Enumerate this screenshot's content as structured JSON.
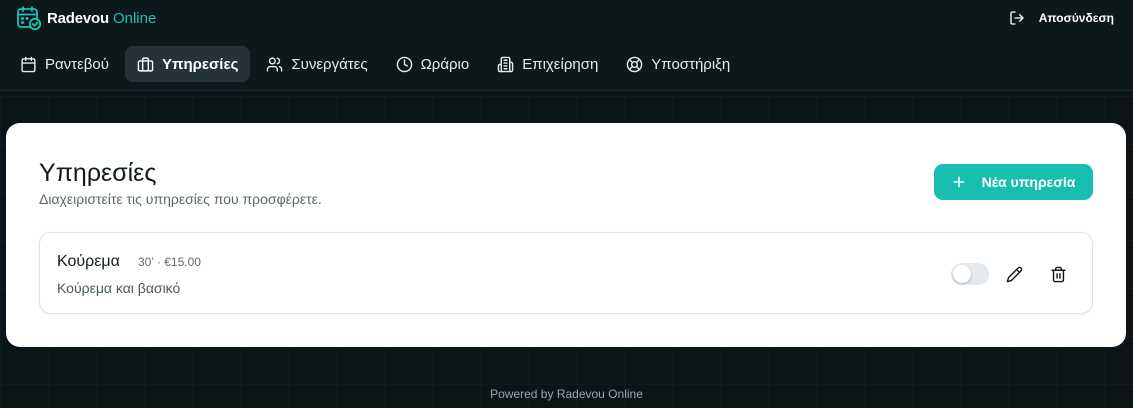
{
  "brand": {
    "name": "Radevou",
    "suffix": "Online",
    "accent_color": "#19c2b2"
  },
  "header": {
    "logout_label": "Αποσύνδεση",
    "logout_icon": "log-out-icon"
  },
  "nav": {
    "items": [
      {
        "label": "Ραντεβού",
        "icon": "calendar-icon",
        "active": false
      },
      {
        "label": "Υπηρεσίες",
        "icon": "briefcase-icon",
        "active": true
      },
      {
        "label": "Συνεργάτες",
        "icon": "users-icon",
        "active": false
      },
      {
        "label": "Ωράριο",
        "icon": "clock-icon",
        "active": false
      },
      {
        "label": "Επιχείρηση",
        "icon": "building-icon",
        "active": false
      },
      {
        "label": "Υποστήριξη",
        "icon": "lifebuoy-icon",
        "active": false
      }
    ]
  },
  "main": {
    "title": "Υπηρεσίες",
    "subtitle": "Διαχειριστείτε τις υπηρεσίες που προσφέρετε.",
    "new_button_label": "Νέα υπηρεσία",
    "new_button_icon": "plus-icon",
    "button_color": "#18bfae"
  },
  "services": [
    {
      "name": "Κούρεμα",
      "meta": "30’ · €15.00",
      "description": "Κούρεμα και βασικό",
      "enabled": false,
      "edit_icon": "pencil-icon",
      "delete_icon": "trash-icon"
    }
  ],
  "footer": {
    "text": "Powered by Radevou Online"
  }
}
